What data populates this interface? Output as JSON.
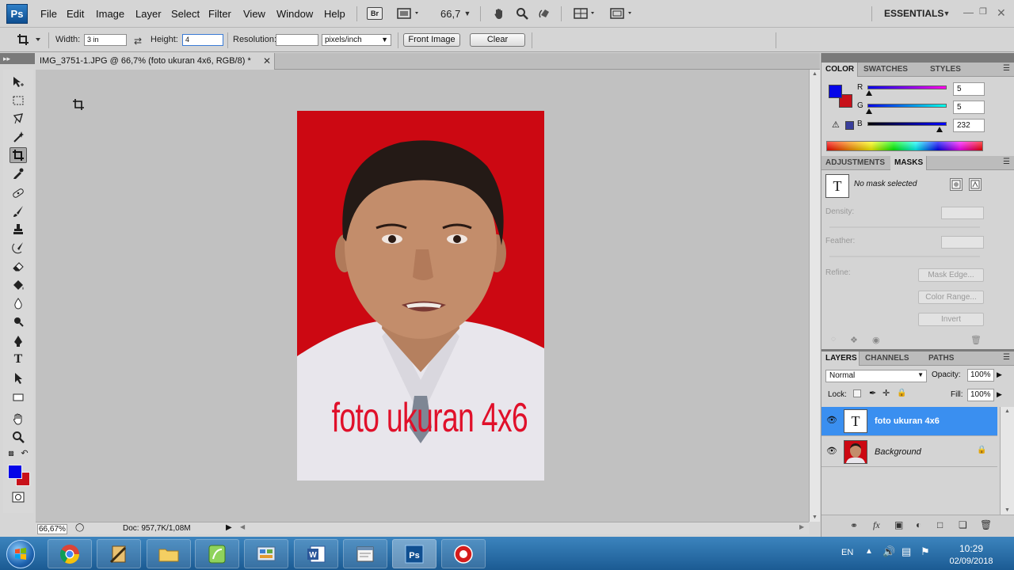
{
  "app": {
    "logo": "Ps",
    "workspace": "ESSENTIALS",
    "zoom_combo": "66,7"
  },
  "menu": {
    "items": [
      "File",
      "Edit",
      "Image",
      "Layer",
      "Select",
      "Filter",
      "View",
      "Window",
      "Help"
    ],
    "bridge_label": "Br"
  },
  "options_bar": {
    "width_label": "Width:",
    "width_value": "3 in",
    "height_label": "Height:",
    "height_value": "4",
    "resolution_label": "Resolution:",
    "resolution_value": "",
    "units": "pixels/inch",
    "front_image": "Front Image",
    "clear": "Clear"
  },
  "document": {
    "tab_title": "IMG_3751-1.JPG @ 66,7% (foto ukuran 4x6, RGB/8) *",
    "caption_text": "foto ukuran 4x6",
    "status_zoom": "66,67%",
    "status_doc": "Doc: 957,7K/1,08M"
  },
  "colors": {
    "foreground": "#0505e8",
    "background": "#c8111a",
    "photo_bg_red": "#cc0812",
    "selection_blue": "#3a8ff0"
  },
  "color_panel": {
    "tabs": [
      "COLOR",
      "SWATCHES",
      "STYLES"
    ],
    "channels": [
      {
        "label": "R",
        "value": "5",
        "level": 0.02
      },
      {
        "label": "G",
        "value": "5",
        "level": 0.02
      },
      {
        "label": "B",
        "value": "232",
        "level": 0.91
      }
    ]
  },
  "masks_panel": {
    "tabs": [
      "ADJUSTMENTS",
      "MASKS"
    ],
    "status": "No mask selected",
    "density_label": "Density:",
    "feather_label": "Feather:",
    "refine_label": "Refine:",
    "mask_edge": "Mask Edge...",
    "color_range": "Color Range...",
    "invert": "Invert"
  },
  "layers_panel": {
    "tabs": [
      "LAYERS",
      "CHANNELS",
      "PATHS"
    ],
    "blend_mode": "Normal",
    "opacity_label": "Opacity:",
    "opacity_value": "100%",
    "lock_label": "Lock:",
    "fill_label": "Fill:",
    "fill_value": "100%",
    "layers": [
      {
        "name": "foto ukuran 4x6",
        "thumb": "T",
        "selected": true
      },
      {
        "name": "Background",
        "thumb": "",
        "selected": false
      }
    ]
  },
  "taskbar": {
    "language": "EN",
    "time": "10:29",
    "date": "02/09/2018"
  }
}
